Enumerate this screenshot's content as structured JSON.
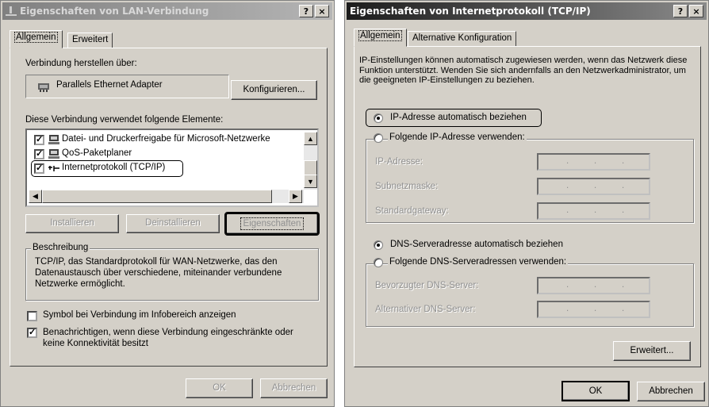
{
  "left_dialog": {
    "title": "Eigenschaften von LAN-Verbindung",
    "help_btn": "?",
    "close_btn": "×",
    "tabs": [
      "Allgemein",
      "Erweitert"
    ],
    "connect_via_label": "Verbindung herstellen über:",
    "adapter_name": "Parallels Ethernet Adapter",
    "configure_btn": "Konfigurieren...",
    "elements_label": "Diese Verbindung verwendet folgende Elemente:",
    "items": [
      {
        "label": "Datei- und Druckerfreigabe für Microsoft-Netzwerke",
        "checked": true
      },
      {
        "label": "QoS-Paketplaner",
        "checked": true
      },
      {
        "label": "Internetprotokoll (TCP/IP)",
        "checked": true
      }
    ],
    "install_btn": "Installieren",
    "uninstall_btn": "Deinstallieren",
    "properties_btn": "Eigenschaften",
    "description_group": "Beschreibung",
    "description_text": "TCP/IP, das Standardprotokoll für WAN-Netzwerke, das den Datenaustausch über verschiedene, miteinander verbundene Netzwerke ermöglicht.",
    "show_icon_label": "Symbol bei Verbindung im Infobereich anzeigen",
    "show_icon_checked": false,
    "notify_label": "Benachrichtigen, wenn diese Verbindung eingeschränkte oder keine Konnektivität besitzt",
    "notify_checked": true,
    "ok_btn": "OK",
    "cancel_btn": "Abbrechen"
  },
  "right_dialog": {
    "title": "Eigenschaften von Internetprotokoll (TCP/IP)",
    "help_btn": "?",
    "close_btn": "×",
    "tabs": [
      "Allgemein",
      "Alternative Konfiguration"
    ],
    "intro_text": "IP-Einstellungen können automatisch zugewiesen werden, wenn das Netzwerk diese Funktion unterstützt. Wenden Sie sich andernfalls an den Netzwerkadministrator, um die geeigneten IP-Einstellungen zu beziehen.",
    "ip_auto_label": "IP-Adresse automatisch beziehen",
    "ip_manual_label": "Folgende IP-Adresse verwenden:",
    "ip_address_label": "IP-Adresse:",
    "subnet_label": "Subnetzmaske:",
    "gateway_label": "Standardgateway:",
    "dns_auto_label": "DNS-Serveradresse automatisch beziehen",
    "dns_manual_label": "Folgende DNS-Serveradressen verwenden:",
    "dns_preferred_label": "Bevorzugter DNS-Server:",
    "dns_alternate_label": "Alternativer DNS-Server:",
    "ip_dot": ".",
    "advanced_btn": "Erweitert...",
    "ok_btn": "OK",
    "cancel_btn": "Abbrechen"
  }
}
